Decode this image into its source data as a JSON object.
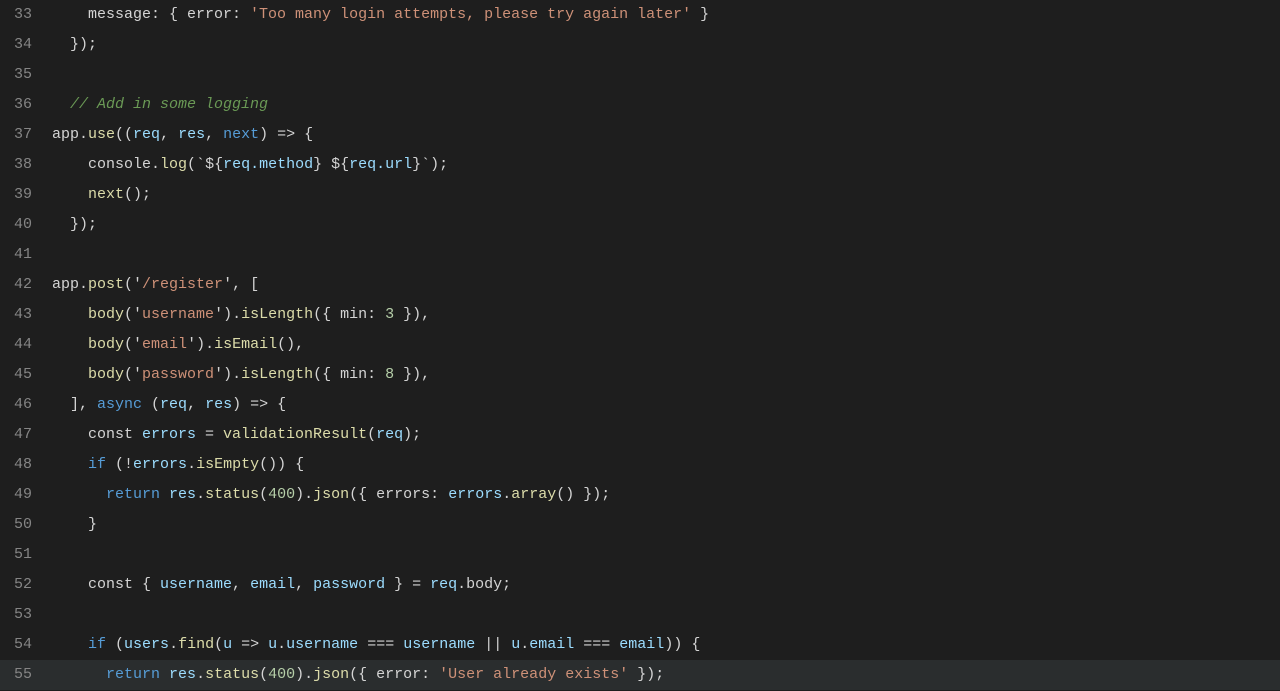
{
  "editor": {
    "background": "#1e1e1e",
    "lines": [
      {
        "number": 33,
        "tokens": [
          {
            "text": "    message: { error: ",
            "class": "c-white"
          },
          {
            "text": "'Too many login attempts, please try again later'",
            "class": "c-string"
          },
          {
            "text": " }",
            "class": "c-white"
          }
        ]
      },
      {
        "number": 34,
        "tokens": [
          {
            "text": "  });",
            "class": "c-white"
          }
        ]
      },
      {
        "number": 35,
        "tokens": []
      },
      {
        "number": 36,
        "tokens": [
          {
            "text": "  // Add in some logging",
            "class": "c-comment"
          }
        ]
      },
      {
        "number": 37,
        "tokens": [
          {
            "text": "app.",
            "class": "c-white"
          },
          {
            "text": "use",
            "class": "c-method"
          },
          {
            "text": "((",
            "class": "c-white"
          },
          {
            "text": "req",
            "class": "c-param"
          },
          {
            "text": ", ",
            "class": "c-white"
          },
          {
            "text": "res",
            "class": "c-cyan"
          },
          {
            "text": ", ",
            "class": "c-white"
          },
          {
            "text": "next",
            "class": "c-keyword"
          },
          {
            "text": ") => {",
            "class": "c-white"
          }
        ]
      },
      {
        "number": 38,
        "tokens": [
          {
            "text": "    console.",
            "class": "c-white"
          },
          {
            "text": "log",
            "class": "c-method"
          },
          {
            "text": "(`",
            "class": "c-white"
          },
          {
            "text": "${",
            "class": "c-white"
          },
          {
            "text": "req.method",
            "class": "c-cyan"
          },
          {
            "text": "}",
            "class": "c-white"
          },
          {
            "text": " ",
            "class": "c-string"
          },
          {
            "text": "${",
            "class": "c-white"
          },
          {
            "text": "req.url",
            "class": "c-cyan"
          },
          {
            "text": "}",
            "class": "c-white"
          },
          {
            "text": "`);",
            "class": "c-white"
          }
        ]
      },
      {
        "number": 39,
        "tokens": [
          {
            "text": "    ",
            "class": "c-white"
          },
          {
            "text": "next",
            "class": "c-method"
          },
          {
            "text": "();",
            "class": "c-white"
          }
        ]
      },
      {
        "number": 40,
        "tokens": [
          {
            "text": "  });",
            "class": "c-white"
          }
        ]
      },
      {
        "number": 41,
        "tokens": []
      },
      {
        "number": 42,
        "tokens": [
          {
            "text": "app.",
            "class": "c-white"
          },
          {
            "text": "post",
            "class": "c-method"
          },
          {
            "text": "('",
            "class": "c-white"
          },
          {
            "text": "/register",
            "class": "c-string"
          },
          {
            "text": "', [",
            "class": "c-white"
          }
        ]
      },
      {
        "number": 43,
        "tokens": [
          {
            "text": "    ",
            "class": "c-white"
          },
          {
            "text": "body",
            "class": "c-method"
          },
          {
            "text": "('",
            "class": "c-white"
          },
          {
            "text": "username",
            "class": "c-string"
          },
          {
            "text": "').",
            "class": "c-white"
          },
          {
            "text": "isLength",
            "class": "c-method"
          },
          {
            "text": "({ min: ",
            "class": "c-white"
          },
          {
            "text": "3",
            "class": "c-number"
          },
          {
            "text": " }),",
            "class": "c-white"
          }
        ]
      },
      {
        "number": 44,
        "tokens": [
          {
            "text": "    ",
            "class": "c-white"
          },
          {
            "text": "body",
            "class": "c-method"
          },
          {
            "text": "('",
            "class": "c-white"
          },
          {
            "text": "email",
            "class": "c-string"
          },
          {
            "text": "').",
            "class": "c-white"
          },
          {
            "text": "isEmail",
            "class": "c-method"
          },
          {
            "text": "(),",
            "class": "c-white"
          }
        ]
      },
      {
        "number": 45,
        "tokens": [
          {
            "text": "    ",
            "class": "c-white"
          },
          {
            "text": "body",
            "class": "c-method"
          },
          {
            "text": "('",
            "class": "c-white"
          },
          {
            "text": "password",
            "class": "c-string"
          },
          {
            "text": "').",
            "class": "c-white"
          },
          {
            "text": "isLength",
            "class": "c-method"
          },
          {
            "text": "({ min: ",
            "class": "c-white"
          },
          {
            "text": "8",
            "class": "c-number"
          },
          {
            "text": " }),",
            "class": "c-white"
          }
        ]
      },
      {
        "number": 46,
        "tokens": [
          {
            "text": "  ], ",
            "class": "c-white"
          },
          {
            "text": "async",
            "class": "c-keyword"
          },
          {
            "text": " (",
            "class": "c-white"
          },
          {
            "text": "req",
            "class": "c-param"
          },
          {
            "text": ", ",
            "class": "c-white"
          },
          {
            "text": "res",
            "class": "c-cyan"
          },
          {
            "text": ") => {",
            "class": "c-white"
          }
        ]
      },
      {
        "number": 47,
        "tokens": [
          {
            "text": "    const ",
            "class": "c-white"
          },
          {
            "text": "errors",
            "class": "c-cyan"
          },
          {
            "text": " = ",
            "class": "c-white"
          },
          {
            "text": "validationResult",
            "class": "c-method"
          },
          {
            "text": "(",
            "class": "c-white"
          },
          {
            "text": "req",
            "class": "c-param"
          },
          {
            "text": ");",
            "class": "c-white"
          }
        ]
      },
      {
        "number": 48,
        "tokens": [
          {
            "text": "    ",
            "class": "c-white"
          },
          {
            "text": "if",
            "class": "c-keyword"
          },
          {
            "text": " (!",
            "class": "c-white"
          },
          {
            "text": "errors",
            "class": "c-cyan"
          },
          {
            "text": ".",
            "class": "c-white"
          },
          {
            "text": "isEmpty",
            "class": "c-method"
          },
          {
            "text": "()) {",
            "class": "c-white"
          }
        ]
      },
      {
        "number": 49,
        "tokens": [
          {
            "text": "      ",
            "class": "c-white"
          },
          {
            "text": "return",
            "class": "c-keyword"
          },
          {
            "text": " ",
            "class": "c-white"
          },
          {
            "text": "res",
            "class": "c-cyan"
          },
          {
            "text": ".",
            "class": "c-white"
          },
          {
            "text": "status",
            "class": "c-method"
          },
          {
            "text": "(",
            "class": "c-white"
          },
          {
            "text": "400",
            "class": "c-number"
          },
          {
            "text": ").",
            "class": "c-white"
          },
          {
            "text": "json",
            "class": "c-method"
          },
          {
            "text": "({ errors: ",
            "class": "c-white"
          },
          {
            "text": "errors",
            "class": "c-cyan"
          },
          {
            "text": ".",
            "class": "c-white"
          },
          {
            "text": "array",
            "class": "c-method"
          },
          {
            "text": "() });",
            "class": "c-white"
          }
        ]
      },
      {
        "number": 50,
        "tokens": [
          {
            "text": "    }",
            "class": "c-white"
          }
        ]
      },
      {
        "number": 51,
        "tokens": []
      },
      {
        "number": 52,
        "tokens": [
          {
            "text": "    const { ",
            "class": "c-white"
          },
          {
            "text": "username",
            "class": "c-cyan"
          },
          {
            "text": ", ",
            "class": "c-white"
          },
          {
            "text": "email",
            "class": "c-cyan"
          },
          {
            "text": ", ",
            "class": "c-white"
          },
          {
            "text": "password",
            "class": "c-cyan"
          },
          {
            "text": " } = ",
            "class": "c-white"
          },
          {
            "text": "req",
            "class": "c-param"
          },
          {
            "text": ".body;",
            "class": "c-white"
          }
        ]
      },
      {
        "number": 53,
        "tokens": []
      },
      {
        "number": 54,
        "tokens": [
          {
            "text": "    ",
            "class": "c-white"
          },
          {
            "text": "if",
            "class": "c-keyword"
          },
          {
            "text": " (",
            "class": "c-white"
          },
          {
            "text": "users",
            "class": "c-cyan"
          },
          {
            "text": ".",
            "class": "c-white"
          },
          {
            "text": "find",
            "class": "c-method"
          },
          {
            "text": "(",
            "class": "c-white"
          },
          {
            "text": "u",
            "class": "c-param"
          },
          {
            "text": " => ",
            "class": "c-white"
          },
          {
            "text": "u",
            "class": "c-param"
          },
          {
            "text": ".",
            "class": "c-white"
          },
          {
            "text": "username",
            "class": "c-cyan"
          },
          {
            "text": " === ",
            "class": "c-white"
          },
          {
            "text": "username",
            "class": "c-cyan"
          },
          {
            "text": " || ",
            "class": "c-white"
          },
          {
            "text": "u",
            "class": "c-param"
          },
          {
            "text": ".",
            "class": "c-white"
          },
          {
            "text": "email",
            "class": "c-cyan"
          },
          {
            "text": " === ",
            "class": "c-white"
          },
          {
            "text": "email",
            "class": "c-cyan"
          },
          {
            "text": ")) {",
            "class": "c-white"
          }
        ]
      },
      {
        "number": 55,
        "tokens": [
          {
            "text": "      ",
            "class": "c-white"
          },
          {
            "text": "return",
            "class": "c-keyword"
          },
          {
            "text": " ",
            "class": "c-white"
          },
          {
            "text": "res",
            "class": "c-cyan"
          },
          {
            "text": ".",
            "class": "c-white"
          },
          {
            "text": "status",
            "class": "c-method"
          },
          {
            "text": "(",
            "class": "c-white"
          },
          {
            "text": "400",
            "class": "c-number"
          },
          {
            "text": ").",
            "class": "c-white"
          },
          {
            "text": "json",
            "class": "c-method"
          },
          {
            "text": "({ error: ",
            "class": "c-white"
          },
          {
            "text": "'User already exists'",
            "class": "c-string"
          },
          {
            "text": " });",
            "class": "c-white"
          }
        ]
      }
    ]
  }
}
